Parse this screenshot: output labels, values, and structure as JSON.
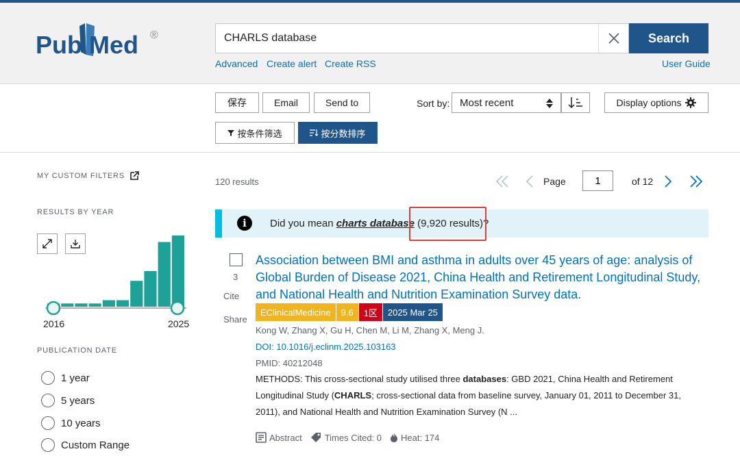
{
  "header": {
    "logo_text_pub": "Pub",
    "logo_text_med": "Med",
    "logo_registered": "®",
    "search_value": "CHARLS database",
    "search_button": "Search",
    "links": {
      "advanced": "Advanced",
      "create_alert": "Create alert",
      "create_rss": "Create RSS",
      "user_guide": "User Guide"
    }
  },
  "toolbar": {
    "save": "保存",
    "email": "Email",
    "send_to": "Send to",
    "sort_by_label": "Sort by:",
    "sort_value": "Most recent",
    "display_options": "Display options",
    "filter_by_condition": "按条件筛选",
    "sort_by_score": "按分数排序"
  },
  "sidebar": {
    "my_custom_filters": "MY CUSTOM FILTERS",
    "results_by_year": "RESULTS BY YEAR",
    "year_start": "2016",
    "year_end": "2025",
    "year_counts": [
      1,
      1,
      1,
      1,
      2,
      2,
      8,
      11,
      20,
      22
    ],
    "publication_date": "PUBLICATION DATE",
    "date_options": [
      "1 year",
      "5 years",
      "10 years",
      "Custom Range"
    ]
  },
  "results": {
    "count": "120 results",
    "page_label": "Page",
    "page_value": "1",
    "of_label": "of 12"
  },
  "did_you_mean": {
    "prefix": "Did you mean ",
    "suggestion": "charts database",
    "suffix": " (9,920 results)?"
  },
  "article": {
    "number": "3",
    "cite": "Cite",
    "share": "Share",
    "title": "Association between BMI and asthma in adults over 45 years of age: analysis of Global Burden of Disease 2021, China Health and Retirement Longitudinal Study, and National Health and Nutrition Examination Survey data.",
    "badges": [
      {
        "text": "EClinicalMedicine",
        "color": "#f0b41e"
      },
      {
        "text": "9.6",
        "color": "#f0b41e"
      },
      {
        "text": "1区",
        "color": "#d0021b"
      },
      {
        "text": "2025 Mar 25",
        "color": "#20558a"
      }
    ],
    "authors": "Kong W, Zhang X, Gu H, Chen M, Li M, Zhang X, Meng J.",
    "doi": "DOI: 10.1016/j.eclinm.2025.103163",
    "pmid": "PMID: 40212048",
    "snippet_1": "METHODS: This cross-sectional study utilised three ",
    "snippet_bold_1": "databases",
    "snippet_2": ": GBD 2021, China Health and Retirement Longitudinal Study (",
    "snippet_bold_2": "CHARLS",
    "snippet_3": "; cross-sectional data from baseline survey, January 01, 2011 to December 31, 2011), and National Health and Nutrition Examination Survey (N ...",
    "abstract": "Abstract",
    "times_cited": "Times Cited: 0",
    "heat": "Heat: 174"
  },
  "colors": {
    "brand": "#20558a",
    "link": "#0071bc",
    "teal": "#00bde3",
    "hist_fill": "#1ea196",
    "highlight": "#e03c3c"
  }
}
